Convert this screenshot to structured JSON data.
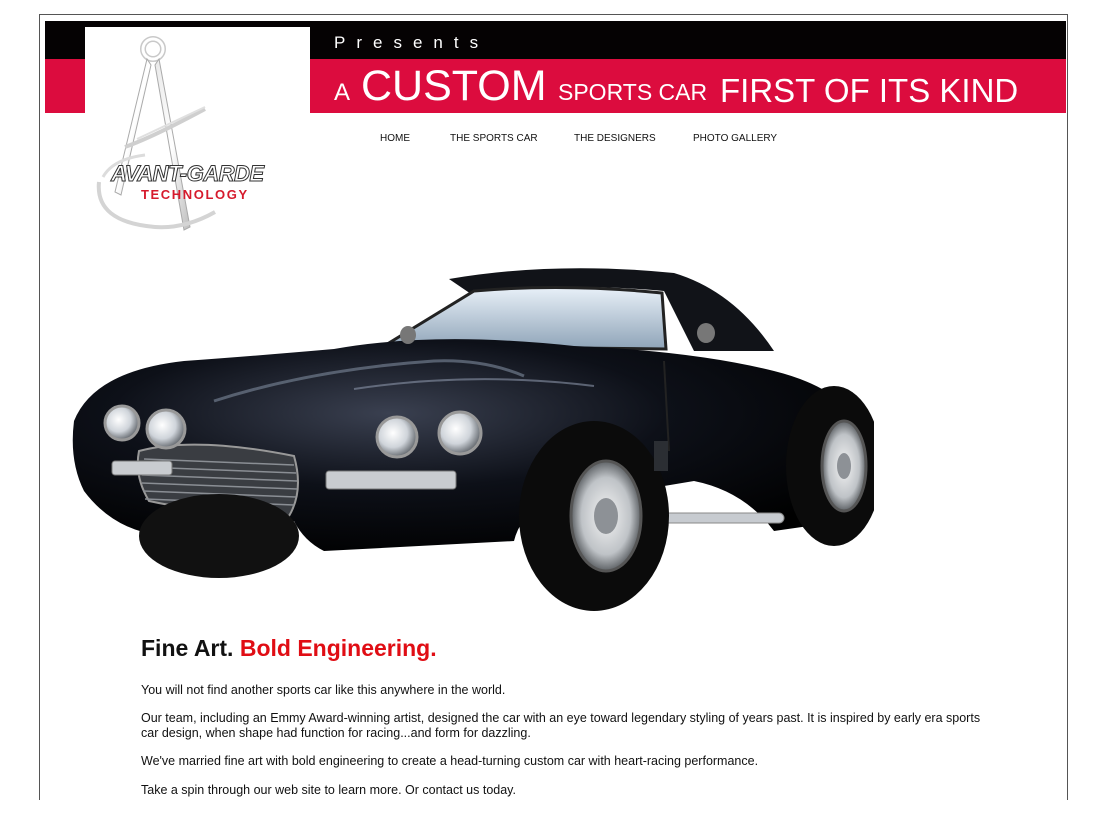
{
  "header": {
    "presents": "Presents",
    "tagline_a": "A",
    "tagline_custom": "CUSTOM",
    "tagline_sports": "SPORTS CAR",
    "tagline_first": "FIRST OF ITS KIND",
    "colors": {
      "band_black": "#050203",
      "band_red": "#dc0c3e"
    }
  },
  "logo": {
    "name": "AVANT-GARDE",
    "sub": "TECHNOLOGY",
    "icon": "compass-icon"
  },
  "nav": {
    "items": [
      "HOME",
      "THE SPORTS CAR",
      "THE DESIGNERS",
      "PHOTO GALLERY"
    ]
  },
  "hero": {
    "image": "black-sports-car-photo"
  },
  "content": {
    "headline_black": "Fine Art.",
    "headline_red": "Bold Engineering.",
    "paragraphs": [
      "You will not find another sports car like this anywhere in the world.",
      "Our team, including an Emmy Award-winning artist, designed the car with an eye toward legendary styling of years past. It is inspired by early era sports car design, when shape had function for racing...and form for dazzling.",
      "We've married fine art with bold engineering to create a head-turning custom car with heart-racing performance.",
      "Take a spin through our web site to learn more. Or contact us today."
    ],
    "accent_color": "#e00d14"
  }
}
